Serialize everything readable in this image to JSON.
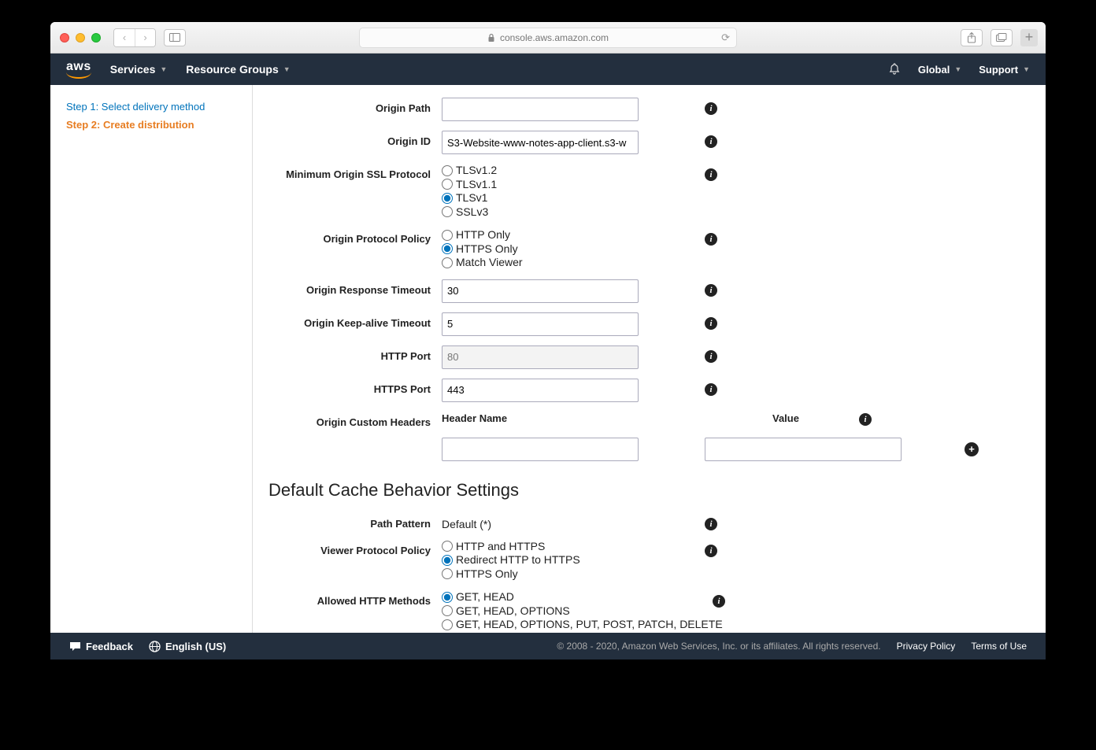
{
  "browser": {
    "url": "console.aws.amazon.com"
  },
  "header": {
    "services": "Services",
    "resource_groups": "Resource Groups",
    "global": "Global",
    "support": "Support"
  },
  "sidebar": {
    "step1": "Step 1: Select delivery method",
    "step2": "Step 2: Create distribution"
  },
  "form": {
    "origin_path": {
      "label": "Origin Path",
      "value": ""
    },
    "origin_id": {
      "label": "Origin ID",
      "value": "S3-Website-www-notes-app-client.s3-w"
    },
    "min_ssl": {
      "label": "Minimum Origin SSL Protocol",
      "opts": [
        "TLSv1.2",
        "TLSv1.1",
        "TLSv1",
        "SSLv3"
      ],
      "selected": "TLSv1"
    },
    "origin_protocol": {
      "label": "Origin Protocol Policy",
      "opts": [
        "HTTP Only",
        "HTTPS Only",
        "Match Viewer"
      ],
      "selected": "HTTPS Only"
    },
    "response_timeout": {
      "label": "Origin Response Timeout",
      "value": "30"
    },
    "keepalive_timeout": {
      "label": "Origin Keep-alive Timeout",
      "value": "5"
    },
    "http_port": {
      "label": "HTTP Port",
      "value": "80"
    },
    "https_port": {
      "label": "HTTPS Port",
      "value": "443"
    },
    "custom_headers": {
      "label": "Origin Custom Headers",
      "header_name": "Header Name",
      "value_label": "Value"
    }
  },
  "section": {
    "cache_title": "Default Cache Behavior Settings",
    "path_pattern": {
      "label": "Path Pattern",
      "value": "Default (*)"
    },
    "viewer_protocol": {
      "label": "Viewer Protocol Policy",
      "opts": [
        "HTTP and HTTPS",
        "Redirect HTTP to HTTPS",
        "HTTPS Only"
      ],
      "selected": "Redirect HTTP to HTTPS"
    },
    "allowed_methods": {
      "label": "Allowed HTTP Methods",
      "opts": [
        "GET, HEAD",
        "GET, HEAD, OPTIONS",
        "GET, HEAD, OPTIONS, PUT, POST, PATCH, DELETE"
      ],
      "selected": "GET, HEAD"
    }
  },
  "footer": {
    "feedback": "Feedback",
    "language": "English (US)",
    "copyright": "© 2008 - 2020, Amazon Web Services, Inc. or its affiliates. All rights reserved.",
    "privacy": "Privacy Policy",
    "terms": "Terms of Use"
  }
}
